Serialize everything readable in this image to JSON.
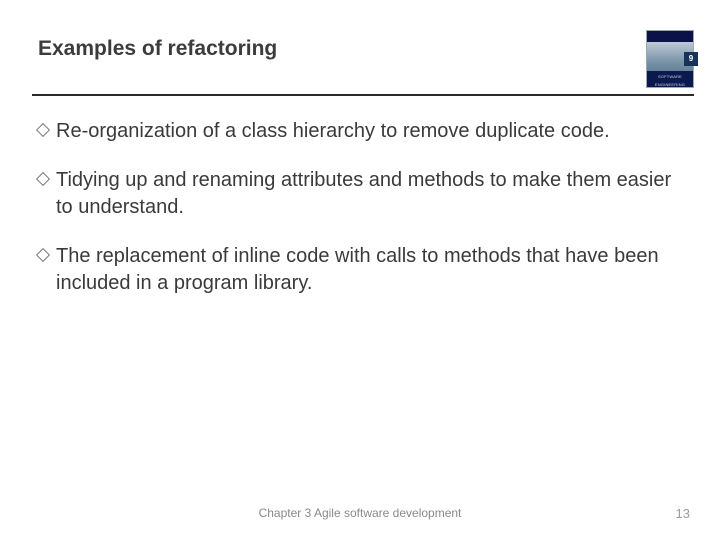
{
  "header": {
    "title": "Examples of refactoring",
    "book": {
      "label": "SOFTWARE ENGINEERING",
      "edition": "9"
    }
  },
  "bullets": [
    {
      "text": "Re-organization of a class hierarchy to remove duplicate code."
    },
    {
      "text": "Tidying up and renaming attributes and methods to make them easier to understand."
    },
    {
      "text": "The replacement of inline code with calls to methods that have been included in a program library."
    }
  ],
  "footer": {
    "chapter": "Chapter 3 Agile software development",
    "page": "13"
  }
}
